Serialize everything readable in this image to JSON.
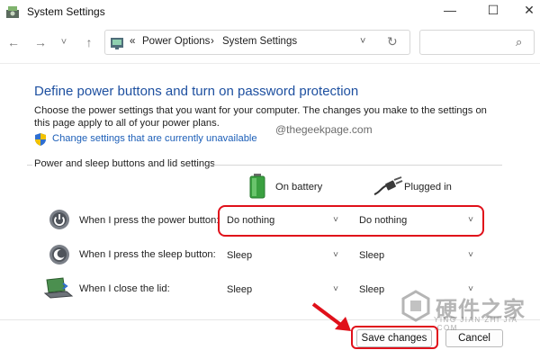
{
  "window": {
    "title": "System Settings",
    "minimize": "—",
    "maximize": "☐",
    "close": "✕"
  },
  "nav": {
    "back": "←",
    "forward": "→",
    "recent": "˅",
    "up": "↑"
  },
  "address": {
    "overflow": "«",
    "crumbs": [
      "Power Options",
      "System Settings"
    ],
    "separator": "›",
    "dropdown": "˅",
    "refresh": "↻"
  },
  "search": {
    "icon": "⌕"
  },
  "content": {
    "heading": "Define power buttons and turn on password protection",
    "description": "Choose the power settings that you want for your computer. The changes you make to the settings on this page apply to all of your power plans.",
    "change_link": "Change settings that are currently unavailable",
    "watermark": "@thegeekpage.com",
    "group_label": "Power and sleep buttons and lid settings",
    "columns": {
      "battery": "On battery",
      "plugged": "Plugged in"
    },
    "rows": [
      {
        "label": "When I press the power button:",
        "battery": "Do nothing",
        "plugged": "Do nothing"
      },
      {
        "label": "When I press the sleep button:",
        "battery": "Sleep",
        "plugged": "Sleep"
      },
      {
        "label": "When I close the lid:",
        "battery": "Sleep",
        "plugged": "Sleep"
      }
    ],
    "chevron": "˅"
  },
  "footer": {
    "save": "Save changes",
    "cancel": "Cancel"
  },
  "brand": {
    "name": "硬件之家",
    "sub": "YING JIAN ZHI JIA .COM"
  },
  "colors": {
    "accent_blue": "#1e50a0",
    "link_blue": "#1d5fb8",
    "highlight_red": "#e0101a"
  }
}
